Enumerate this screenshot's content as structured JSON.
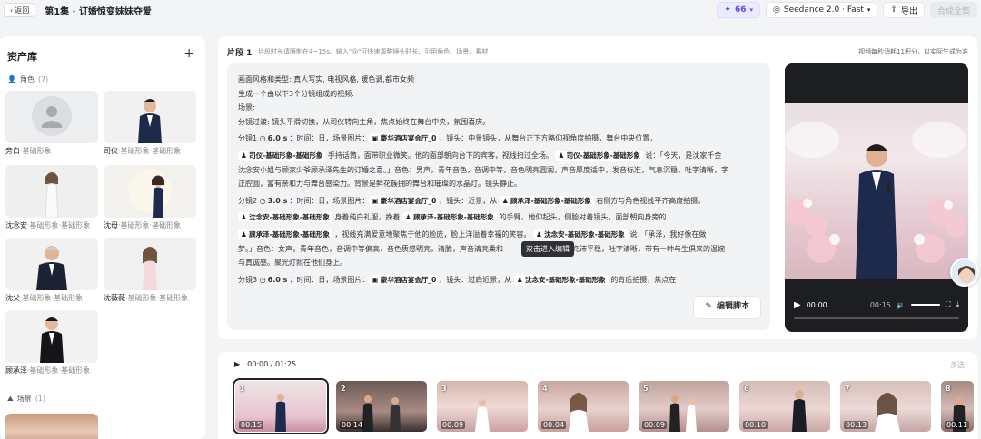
{
  "header": {
    "back_label": "返回",
    "title": "第1集 · 订婚惊变妹妹夺爱",
    "credits": "66",
    "model": "Seedance 2.0 · Fast",
    "export_label": "导出",
    "generate_all_label": "合成全集"
  },
  "sidebar": {
    "title": "资产库",
    "characters_section": "角色",
    "characters_count": "(7)",
    "characters": [
      {
        "name": "旁白",
        "sub": "·基础形象"
      },
      {
        "name": "司仪",
        "sub": "·基础形象·基础形象"
      },
      {
        "name": "沈念安",
        "sub": "·基础形象·基础形象"
      },
      {
        "name": "沈母",
        "sub": "·基础形象·基础形象"
      },
      {
        "name": "沈父",
        "sub": "·基础形象·基础形象"
      },
      {
        "name": "沈薇薇",
        "sub": "·基础形象·基础形象"
      },
      {
        "name": "顾承泽",
        "sub": "·基础形象·基础形象"
      }
    ],
    "scenes_section": "场景",
    "scenes_count": "(1)"
  },
  "segment": {
    "title": "片段 1",
    "hint": "片段时长请限制在4~15s。输入\"@\"可快速调整镜头时长、引用角色、场景、素材",
    "cost_note": "视频每秒消耗11积分，以实际生成为准",
    "line1": "画面风格和类型: 真人写实, 电视风格, 暖色调,都市女频",
    "line2": "生成一个由以下3个分镜组成的视频:",
    "line3": "场景:",
    "line4": "分镜过渡: 镜头平滑切换，从司仪转向主角，焦点始终在舞台中央，氛围喜庆。",
    "shot1_prefix": "分镜1",
    "shot1_dur": "6.0 s",
    "shot1_a": "：时间：日，场景图片：",
    "scene_tag": "豪华酒店宴会厅_0",
    "shot1_b": "，镜头：中景镜头，从舞台正下方略仰视角度拍摄，舞台中央位置，",
    "tag_siyi": "司仪-基础形象-基础形象",
    "shot1_c": "手持话筒，面带职业微笑。他的面部朝向台下的宾客，视线扫过全场。",
    "shot1_d": "说：「今天，是沈家千金",
    "shot1_e": "沈念安小姐与顾家少爷顾承泽先生的订婚之喜。」音色：男声，青年音色，音调中等，音色明亮圆润，声音厚度适中，发音标准，气息沉稳，吐字清晰，字",
    "shot1_f": "正腔圆，富有亲和力与舞台感染力。背景是鲜花簇拥的舞台和璀璨的水晶灯。镜头静止。",
    "shot2_prefix": "分镜2",
    "shot2_dur": "3.0 s",
    "shot2_a": "：时间：日，场景图片：",
    "shot2_b": "，镜头：近景，从",
    "tag_gu": "顾承泽-基础形象-基础形象",
    "shot2_c": "右侧方与角色视线平齐高度拍摄。",
    "tag_shen": "沈念安-基础形象-基础形象",
    "shot2_d": "身着纯白礼服，挽着",
    "shot2_e": "的手臂，她仰起头，侧脸对着镜头，面部朝向身旁的",
    "shot2_f": "，视线充满爱意地聚焦于他的脸庞，脸上洋溢着幸福的笑容。",
    "shot2_g": "说：「承泽，我好像在做",
    "shot2_h": "梦。」音色：女声，青年音色，音调中等偏高，音色质感明亮，清脆，声音清亮柔和",
    "shot2_h2": "气息充沛平稳，吐字清晰，带有一种与生俱来的温婉",
    "shot2_i": "与真诚感。聚光灯照在他们身上。",
    "shot3_prefix": "分镜3",
    "shot3_dur": "6.0 s",
    "shot3_a": "：时间：日，场景图片：",
    "shot3_b": "，镜头：过肩近景，从",
    "shot3_c": "的背后拍摄，焦点在",
    "tooltip": "双击进入编辑",
    "edit_button": "编辑脚本"
  },
  "player": {
    "current": "00:00",
    "total": "00:15"
  },
  "timeline": {
    "time": "00:00 / 01:25",
    "multi_select": "多选",
    "clips": [
      {
        "n": "1",
        "d": "00:15"
      },
      {
        "n": "2",
        "d": "00:14"
      },
      {
        "n": "3",
        "d": "00:09"
      },
      {
        "n": "4",
        "d": "00:04"
      },
      {
        "n": "5",
        "d": "00:09"
      },
      {
        "n": "6",
        "d": "00:10"
      },
      {
        "n": "7",
        "d": "00:13"
      },
      {
        "n": "8",
        "d": "00:11"
      }
    ]
  },
  "colors": {
    "accent": "#5b4be0",
    "dark": "#1f2329",
    "script_bg": "#f2f3f5"
  }
}
